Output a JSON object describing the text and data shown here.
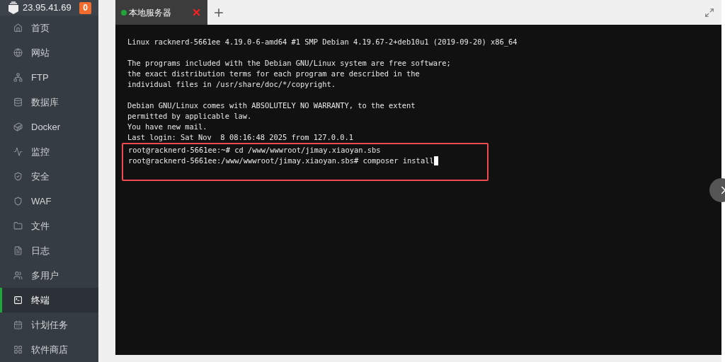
{
  "sidebar": {
    "server_ip": "23.95.41.69",
    "badge": "0",
    "items": [
      {
        "label": "首页",
        "selected": false
      },
      {
        "label": "网站",
        "selected": false
      },
      {
        "label": "FTP",
        "selected": false
      },
      {
        "label": "数据库",
        "selected": false
      },
      {
        "label": "Docker",
        "selected": false
      },
      {
        "label": "监控",
        "selected": false
      },
      {
        "label": "安全",
        "selected": false
      },
      {
        "label": "WAF",
        "selected": false
      },
      {
        "label": "文件",
        "selected": false
      },
      {
        "label": "日志",
        "selected": false
      },
      {
        "label": "多用户",
        "selected": false
      },
      {
        "label": "终端",
        "selected": true
      },
      {
        "label": "计划任务",
        "selected": false
      },
      {
        "label": "软件商店",
        "selected": false
      }
    ]
  },
  "tabs": [
    {
      "label": "本地服务器",
      "color": "#20a53a",
      "selected": true
    }
  ],
  "terminal": {
    "output": [
      [
        "Linux racknerd-5661ee 4.19.0-6-amd64 #1 SMP Debian 4.19.67-2+deb10u1 (2019-09-20) x86_64"
      ],
      [
        "The programs included with the Debian GNU/Linux system are free software;",
        "the exact distribution terms for each program are described in the",
        "individual files in /usr/share/doc/*/copyright."
      ],
      [
        "Debian GNU/Linux comes with ABSOLUTELY NO WARRANTY, to the extent",
        "permitted by applicable law.",
        "You have new mail.",
        "Last login: Sat Nov  8 08:16:48 2025 from 127.0.0.1"
      ]
    ],
    "commands": {
      "highlighted": true,
      "cursor": true,
      "lines": [
        "root@racknerd-5661ee:~# cd /www/wwwroot/jimay.xiaoyan.sbs",
        "root@racknerd-5661ee:/www/wwwroot/jimay.xiaoyan.sbs# composer install"
      ]
    }
  }
}
